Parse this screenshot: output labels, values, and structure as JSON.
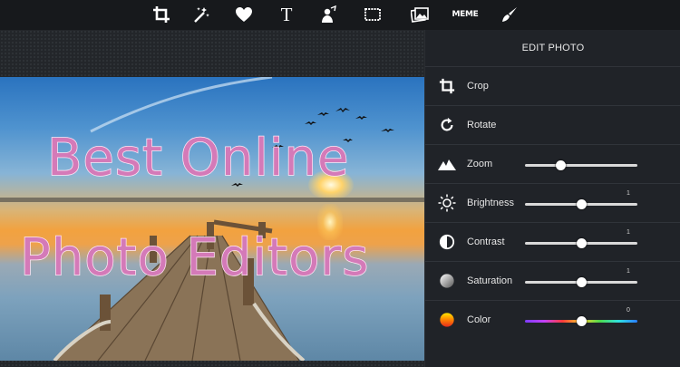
{
  "toolbar": {
    "tools": [
      {
        "name": "crop",
        "icon": "crop-icon"
      },
      {
        "name": "magic",
        "icon": "magic-wand-icon"
      },
      {
        "name": "favorite",
        "icon": "heart-icon"
      },
      {
        "name": "text",
        "icon": "text-icon",
        "label": "T"
      },
      {
        "name": "stickers",
        "icon": "clipart-icon"
      },
      {
        "name": "frames",
        "icon": "frame-icon"
      },
      {
        "name": "photo",
        "icon": "image-icon"
      },
      {
        "name": "meme",
        "icon": "meme-icon",
        "label": "MEME"
      },
      {
        "name": "paint",
        "icon": "paintbrush-icon"
      }
    ]
  },
  "canvas": {
    "headline_line1": "Best Online",
    "headline_line2": "Photo Editors",
    "headline_color": "#d47ab8"
  },
  "panel": {
    "title": "EDIT PHOTO",
    "items": [
      {
        "label": "Crop",
        "icon": "crop-icon"
      },
      {
        "label": "Rotate",
        "icon": "rotate-icon"
      },
      {
        "label": "Zoom",
        "icon": "mountains-icon",
        "slider": 0.32
      },
      {
        "label": "Brightness",
        "icon": "sun-icon",
        "slider": 0.5,
        "value": "1"
      },
      {
        "label": "Contrast",
        "icon": "contrast-icon",
        "slider": 0.5,
        "value": "1"
      },
      {
        "label": "Saturation",
        "icon": "saturation-icon",
        "slider": 0.5,
        "value": "1"
      },
      {
        "label": "Color",
        "icon": "color-icon",
        "slider": 0.5,
        "value": "0"
      }
    ]
  }
}
